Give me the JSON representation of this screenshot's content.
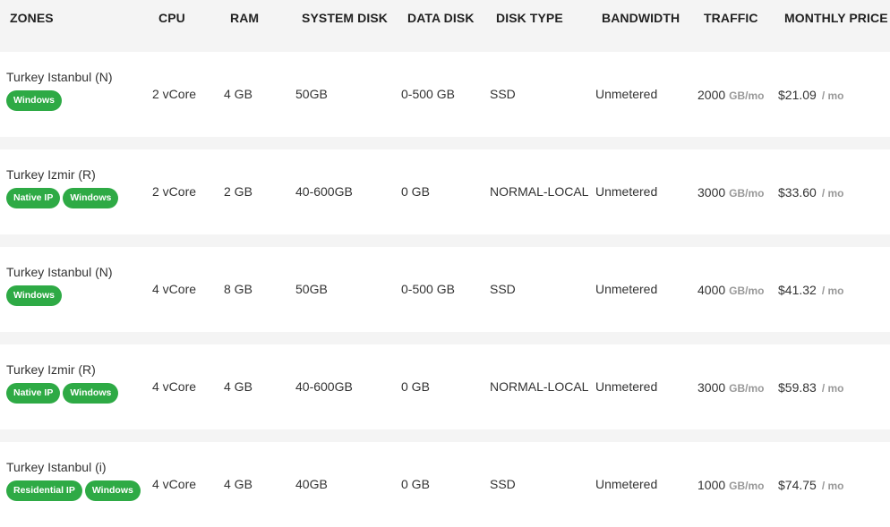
{
  "headers": {
    "zones": "ZONES",
    "cpu": "CPU",
    "ram": "RAM",
    "system_disk": "SYSTEM DISK",
    "data_disk": "DATA DISK",
    "disk_type": "DISK TYPE",
    "bandwidth": "BANDWIDTH",
    "traffic": "TRAFFIC",
    "monthly_price": "MONTHLY PRICE"
  },
  "rows": [
    {
      "zone": "Turkey Istanbul (N)",
      "badges": [
        "Windows",
        ""
      ],
      "cpu": "2 vCore",
      "ram": "4 GB",
      "system_disk": "50GB",
      "data_disk": "0-500 GB",
      "disk_type": "SSD",
      "bandwidth": "Unmetered",
      "traffic_value": "2000",
      "traffic_unit": "GB/mo",
      "price": "$21.09",
      "price_unit": "/ mo"
    },
    {
      "zone": "Turkey Izmir (R)",
      "badges": [
        "Native IP",
        "Windows"
      ],
      "cpu": "2 vCore",
      "ram": "2 GB",
      "system_disk": "40-600GB",
      "data_disk": "0 GB",
      "disk_type": "NORMAL-LOCAL",
      "bandwidth": "Unmetered",
      "traffic_value": "3000",
      "traffic_unit": "GB/mo",
      "price": "$33.60",
      "price_unit": "/ mo"
    },
    {
      "zone": "Turkey Istanbul (N)",
      "badges": [
        "Windows",
        ""
      ],
      "cpu": "4 vCore",
      "ram": "8 GB",
      "system_disk": "50GB",
      "data_disk": "0-500 GB",
      "disk_type": "SSD",
      "bandwidth": "Unmetered",
      "traffic_value": "4000",
      "traffic_unit": "GB/mo",
      "price": "$41.32",
      "price_unit": "/ mo"
    },
    {
      "zone": "Turkey Izmir (R)",
      "badges": [
        "Native IP",
        "Windows"
      ],
      "cpu": "4 vCore",
      "ram": "4 GB",
      "system_disk": "40-600GB",
      "data_disk": "0 GB",
      "disk_type": "NORMAL-LOCAL",
      "bandwidth": "Unmetered",
      "traffic_value": "3000",
      "traffic_unit": "GB/mo",
      "price": "$59.83",
      "price_unit": "/ mo"
    },
    {
      "zone": "Turkey Istanbul (i)",
      "badges": [
        "Residential IP",
        "Windows"
      ],
      "cpu": "4 vCore",
      "ram": "4 GB",
      "system_disk": "40GB",
      "data_disk": "0 GB",
      "disk_type": "SSD",
      "bandwidth": "Unmetered",
      "traffic_value": "1000",
      "traffic_unit": "GB/mo",
      "price": "$74.75",
      "price_unit": "/ mo"
    }
  ],
  "colors": {
    "badge": "#2eaa45",
    "row_background": "#ffffff",
    "page_background": "#f4f4f4"
  }
}
